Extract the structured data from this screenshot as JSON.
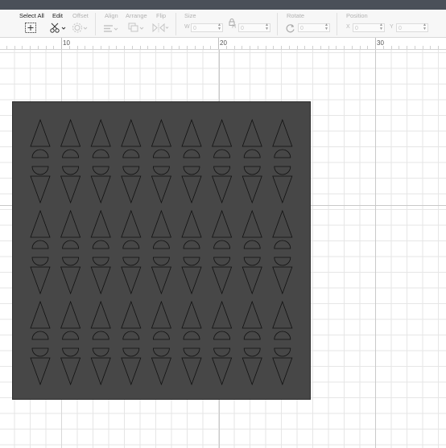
{
  "toolbar": {
    "select_all_label": "Select All",
    "edit_label": "Edit",
    "offset_label": "Offset",
    "align_label": "Align",
    "arrange_label": "Arrange",
    "flip_label": "Flip",
    "size_label": "Size",
    "size_w_label": "W",
    "size_w_value": "0",
    "size_h_label": "H",
    "size_h_value": "0",
    "rotate_label": "Rotate",
    "rotate_value": "0",
    "position_label": "Position",
    "position_x_label": "X",
    "position_x_value": "0",
    "position_y_label": "Y",
    "position_y_value": "0"
  },
  "ruler": {
    "labels": [
      "10",
      "20",
      "30"
    ]
  },
  "design": {
    "fill_color": "#474747",
    "stroke_color": "#111111",
    "pattern": {
      "columns": 9,
      "row_groups": 3,
      "units_per_group": [
        "triangle-up",
        "half-circle-pair",
        "triangle-down"
      ]
    }
  }
}
